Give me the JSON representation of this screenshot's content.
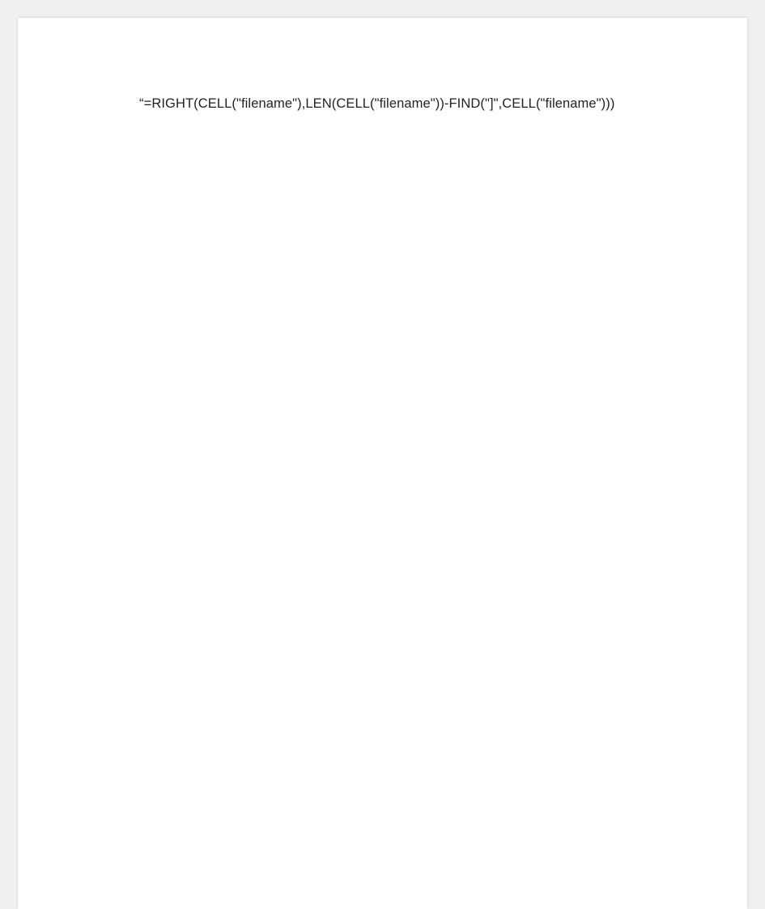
{
  "document": {
    "formula_text": "“=RIGHT(CELL(\"filename\"),LEN(CELL(\"filename\"))-FIND(\"]\",CELL(\"filename\")))"
  }
}
